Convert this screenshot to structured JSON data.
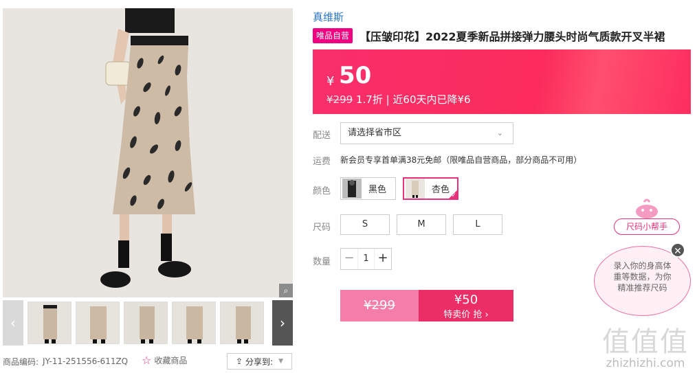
{
  "gallery": {
    "zoom_icon": "magnifier-icon",
    "prev_icon": "chevron-left-icon",
    "next_icon": "chevron-right-icon",
    "thumb_count": 5
  },
  "meta": {
    "code_label": "商品编码:",
    "code_value": "JY-11-251556-611ZQ",
    "favorite_label": "收藏商品",
    "share_label": "分享到:"
  },
  "product": {
    "brand": "真维斯",
    "badge": "唯品自营",
    "title": "【压皱印花】2022夏季新品拼接弹力腰头时尚气质款开叉半裙"
  },
  "price": {
    "yen": "¥",
    "amount": "50",
    "original": "¥299",
    "discount": "1.7折",
    "history": "| 近60天内已降¥6"
  },
  "delivery": {
    "label": "配送",
    "placeholder": "请选择省市区"
  },
  "shipping": {
    "label": "运费",
    "text": "新会员专享首单满38元免邮（限唯品自营商品，部分商品不可用）"
  },
  "colors": {
    "label": "颜色",
    "options": [
      {
        "name": "黑色",
        "selected": false
      },
      {
        "name": "杏色",
        "selected": true
      }
    ]
  },
  "sizes": {
    "label": "尺码",
    "options": [
      "S",
      "M",
      "L"
    ]
  },
  "quantity": {
    "label": "数量",
    "value": "1",
    "minus": "−",
    "plus": "+"
  },
  "buy": {
    "original": "¥299",
    "price": "¥50",
    "label": "特卖价 抢 ›"
  },
  "helper": {
    "tag": "尺码小帮手",
    "bubble_line1": "录入你的身高体",
    "bubble_line2": "重等数据，为你",
    "bubble_line3": "精准推荐尺码",
    "close": "✕"
  },
  "watermark": {
    "logo": "值值值",
    "url": "zhizhizhi.com"
  },
  "colors_theme": {
    "accent": "#f10180",
    "price_banner": "#fb2c5c",
    "brand_link": "#2a76c8"
  }
}
